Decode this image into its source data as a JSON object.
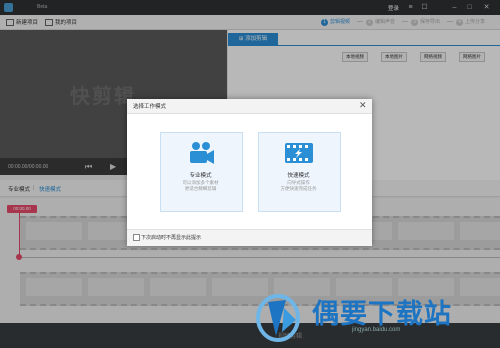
{
  "app": {
    "title": "快剪辑",
    "beta": "Beta",
    "login": "登录"
  },
  "toolbar": {
    "new_project": "新建项目",
    "my_projects": "我的项目"
  },
  "steps": [
    {
      "num": "1",
      "label": "剪辑视频",
      "active": true
    },
    {
      "num": "2",
      "label": "编辑声音",
      "active": false
    },
    {
      "num": "3",
      "label": "保存导出",
      "active": false
    },
    {
      "num": "4",
      "label": "上传分享",
      "active": false
    }
  ],
  "preview": {
    "watermark": "快剪辑",
    "timecode": "00:00.00/00:00.00"
  },
  "right_panel": {
    "tab": "添加剪辑",
    "buttons": [
      "本地视频",
      "本地图片",
      "网络视频",
      "网络图片"
    ]
  },
  "modes": {
    "pro": "专业模式",
    "sep": "|",
    "fast": "快速模式"
  },
  "timeline": {
    "time": "00:00.00"
  },
  "dialog": {
    "title": "选择工作模式",
    "close": "✕",
    "pro": {
      "title": "专业模式",
      "line1": "可以添加多个素材",
      "line2": "更适合精细剪辑"
    },
    "fast": {
      "title": "快速模式",
      "line1": "向导式操作",
      "line2": "方便快速完成任务"
    },
    "checkbox_label": "下次启动时不再显示此提示"
  },
  "bottom": {
    "text": "视频剪辑"
  },
  "site": {
    "brand": "偶要下载站",
    "url": "jingyan.baidu.com"
  },
  "colors": {
    "accent": "#2b8fd6",
    "playhead": "#e84a6a",
    "brand": "#1c74c2"
  }
}
